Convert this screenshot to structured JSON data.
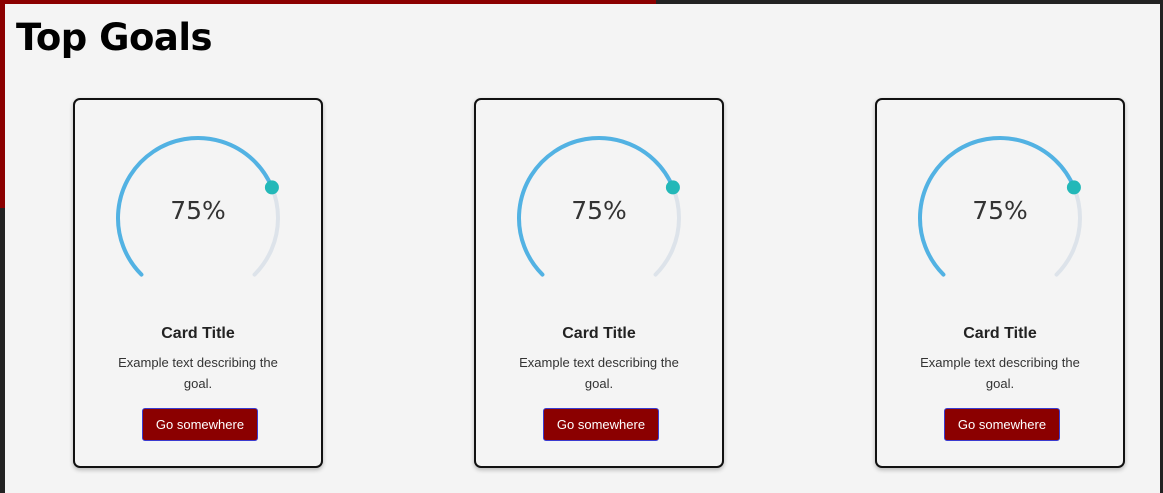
{
  "page": {
    "title": "Top Goals"
  },
  "colors": {
    "accent": "#8b0000",
    "gauge_progress": "#52b2e3",
    "gauge_knob": "#23b8b8",
    "gauge_track": "#dde3ea"
  },
  "cards": [
    {
      "percent": 75,
      "value_label": "75%",
      "title": "Card Title",
      "text": "Example text describing the goal.",
      "button_label": "Go somewhere"
    },
    {
      "percent": 75,
      "value_label": "75%",
      "title": "Card Title",
      "text": "Example text describing the goal.",
      "button_label": "Go somewhere"
    },
    {
      "percent": 75,
      "value_label": "75%",
      "title": "Card Title",
      "text": "Example text describing the goal.",
      "button_label": "Go somewhere"
    }
  ]
}
